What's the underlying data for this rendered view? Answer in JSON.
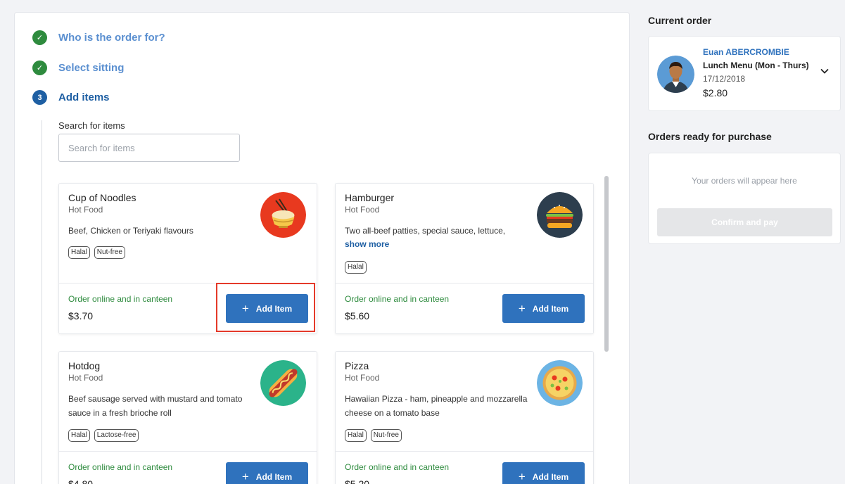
{
  "steps": [
    {
      "label": "Who is the order for?",
      "badge": "✓",
      "state": "done"
    },
    {
      "label": "Select sitting",
      "badge": "✓",
      "state": "done"
    },
    {
      "label": "Add items",
      "badge": "3",
      "state": "active"
    }
  ],
  "search": {
    "label": "Search for items",
    "placeholder": "Search for items",
    "value": ""
  },
  "items": [
    {
      "name": "Cup of Noodles",
      "category": "Hot Food",
      "description": "Beef, Chicken or Teriyaki flavours",
      "show_more": "",
      "tags": [
        "Halal",
        "Nut-free"
      ],
      "availability": "Order online and in canteen",
      "price": "$3.70",
      "button": "Add Item",
      "icon": "noodles-icon"
    },
    {
      "name": "Hamburger",
      "category": "Hot Food",
      "description": "Two all-beef patties, special sauce, lettuce,",
      "show_more": "show more",
      "tags": [
        "Halal"
      ],
      "availability": "Order online and in canteen",
      "price": "$5.60",
      "button": "Add Item",
      "icon": "hamburger-icon"
    },
    {
      "name": "Hotdog",
      "category": "Hot Food",
      "description": "Beef sausage served with mustard and tomato sauce in a fresh brioche roll",
      "show_more": "",
      "tags": [
        "Halal",
        "Lactose-free"
      ],
      "availability": "Order online and in canteen",
      "price": "$4.80",
      "button": "Add Item",
      "icon": "hotdog-icon"
    },
    {
      "name": "Pizza",
      "category": "Hot Food",
      "description": "Hawaiian Pizza - ham, pineapple and mozzarella cheese on a tomato base",
      "show_more": "",
      "tags": [
        "Halal",
        "Nut-free"
      ],
      "availability": "Order online and in canteen",
      "price": "$5.20",
      "button": "Add Item",
      "icon": "pizza-icon"
    }
  ],
  "sidebar": {
    "current_order_title": "Current order",
    "current_order": {
      "child_name": "Euan ABERCROMBIE",
      "menu": "Lunch Menu (Mon - Thurs)",
      "date": "17/12/2018",
      "total": "$2.80"
    },
    "ready_title": "Orders ready for purchase",
    "ready_empty": "Your orders will appear here",
    "confirm_button": "Confirm and pay"
  },
  "colors": {
    "primary": "#2f72bd",
    "success": "#2e8b3e",
    "highlight": "#e43a2a"
  }
}
